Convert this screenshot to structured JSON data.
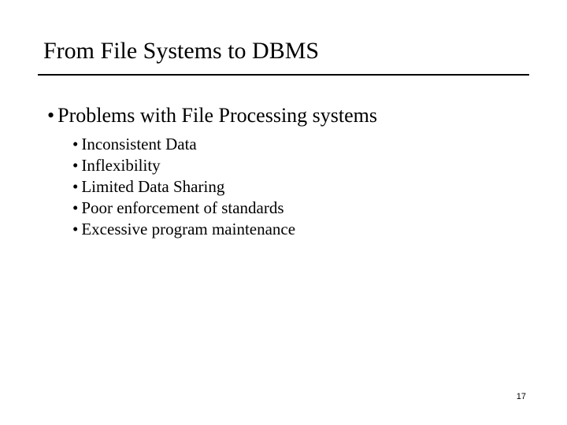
{
  "title": "From File Systems to DBMS",
  "main_bullet": "Problems with File Processing systems",
  "sub_bullets": {
    "b0": "Inconsistent Data",
    "b1": "Inflexibility",
    "b2": "Limited Data Sharing",
    "b3": "Poor enforcement of standards",
    "b4": "Excessive program maintenance"
  },
  "page_number": "17",
  "glyph": "•"
}
